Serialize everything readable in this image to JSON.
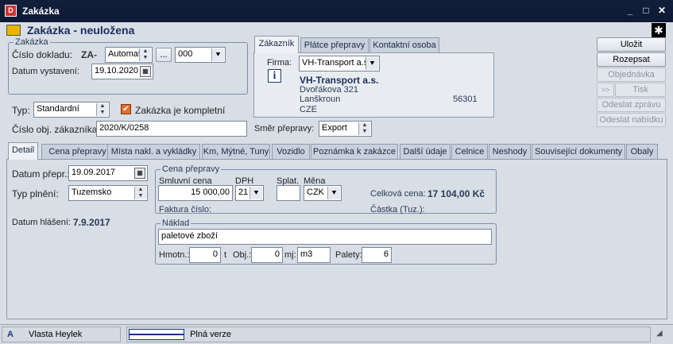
{
  "window": {
    "title": "Zakázka",
    "minimize": "_",
    "maximize": "□",
    "close": "✕"
  },
  "header": {
    "title": "Zakázka - neuložena",
    "settings_icon": "gear-icon"
  },
  "zakazka": {
    "group_label": "Zakázka",
    "doc_number_label": "Číslo dokladu:",
    "doc_prefix": "ZA-",
    "doc_mode": "Automat",
    "ellipsis": "...",
    "doc_series": "000",
    "issue_date_label": "Datum vystavení:",
    "issue_date": "19.10.2020"
  },
  "typ": {
    "label": "Typ:",
    "value": "Standardní",
    "complete_label": "Zakázka je kompletní",
    "complete_checked": true
  },
  "order_number": {
    "label": "Číslo obj. zákazníka:",
    "value": "2020/K/0258"
  },
  "direction": {
    "label": "Směr přepravy:",
    "value": "Export"
  },
  "customer_tabs": [
    {
      "label": "Zákazník",
      "active": true
    },
    {
      "label": "Plátce přepravy",
      "active": false
    },
    {
      "label": "Kontaktní osoba",
      "active": false
    }
  ],
  "customer": {
    "firm_label": "Firma:",
    "firm_select": "VH-Transport a.s.",
    "name": "VH-Transport a.s.",
    "street": "Dvořákova 321",
    "city": "Lanškroun",
    "zip": "56301",
    "country": "CZE",
    "info_icon": "i"
  },
  "actions": {
    "save": "Uložit",
    "split": "Rozepsat",
    "order": "Objednávka",
    "print_prefix": ">>",
    "print": "Tisk",
    "send_message": "Odeslat zprávu",
    "send_offer": "Odeslat nabídku"
  },
  "tabs": [
    {
      "label": "Detail",
      "active": true
    },
    {
      "label": "Cena přepravy"
    },
    {
      "label": "Místa nakl. a vykládky"
    },
    {
      "label": "Km, Mýtné, Tuny"
    },
    {
      "label": "Vozidlo"
    },
    {
      "label": "Poznámka k zakázce"
    },
    {
      "label": "Další údaje"
    },
    {
      "label": "Celnice"
    },
    {
      "label": "Neshody"
    },
    {
      "label": "Související dokumenty"
    },
    {
      "label": "Obaly"
    }
  ],
  "detail": {
    "transport_date_label": "Datum přepr.:",
    "transport_date": "19.09.2017",
    "fulfilment_label": "Typ plnění:",
    "fulfilment": "Tuzemsko",
    "report_date_label": "Datum hlášení:",
    "report_date": "7.9.2017"
  },
  "price": {
    "group_label": "Cena přepravy",
    "contract_label": "Smluvní cena",
    "contract_value": "15 000,00",
    "vat_label": "DPH",
    "vat_value": "21",
    "due_label": "Splat.",
    "due_value": "",
    "currency_label": "Měna",
    "currency_value": "CZK",
    "total_label": "Celková cena:",
    "total_value": "17 104,00 Kč",
    "invoice_label": "Faktura číslo:",
    "amount_local_label": "Částka (Tuz.):"
  },
  "cargo": {
    "group_label": "Náklad",
    "description": "paletové zboží",
    "weight_label": "Hmotn.:",
    "weight_value": "0",
    "weight_unit": "t",
    "volume_label": "Obj.:",
    "volume_value": "0",
    "volume_unit_label": "mj:",
    "volume_unit": "m3",
    "pallets_label": "Palety:",
    "pallets_value": "6"
  },
  "status": {
    "icon": "A",
    "user": "Vlasta Heylek",
    "version": "Plná verze"
  }
}
